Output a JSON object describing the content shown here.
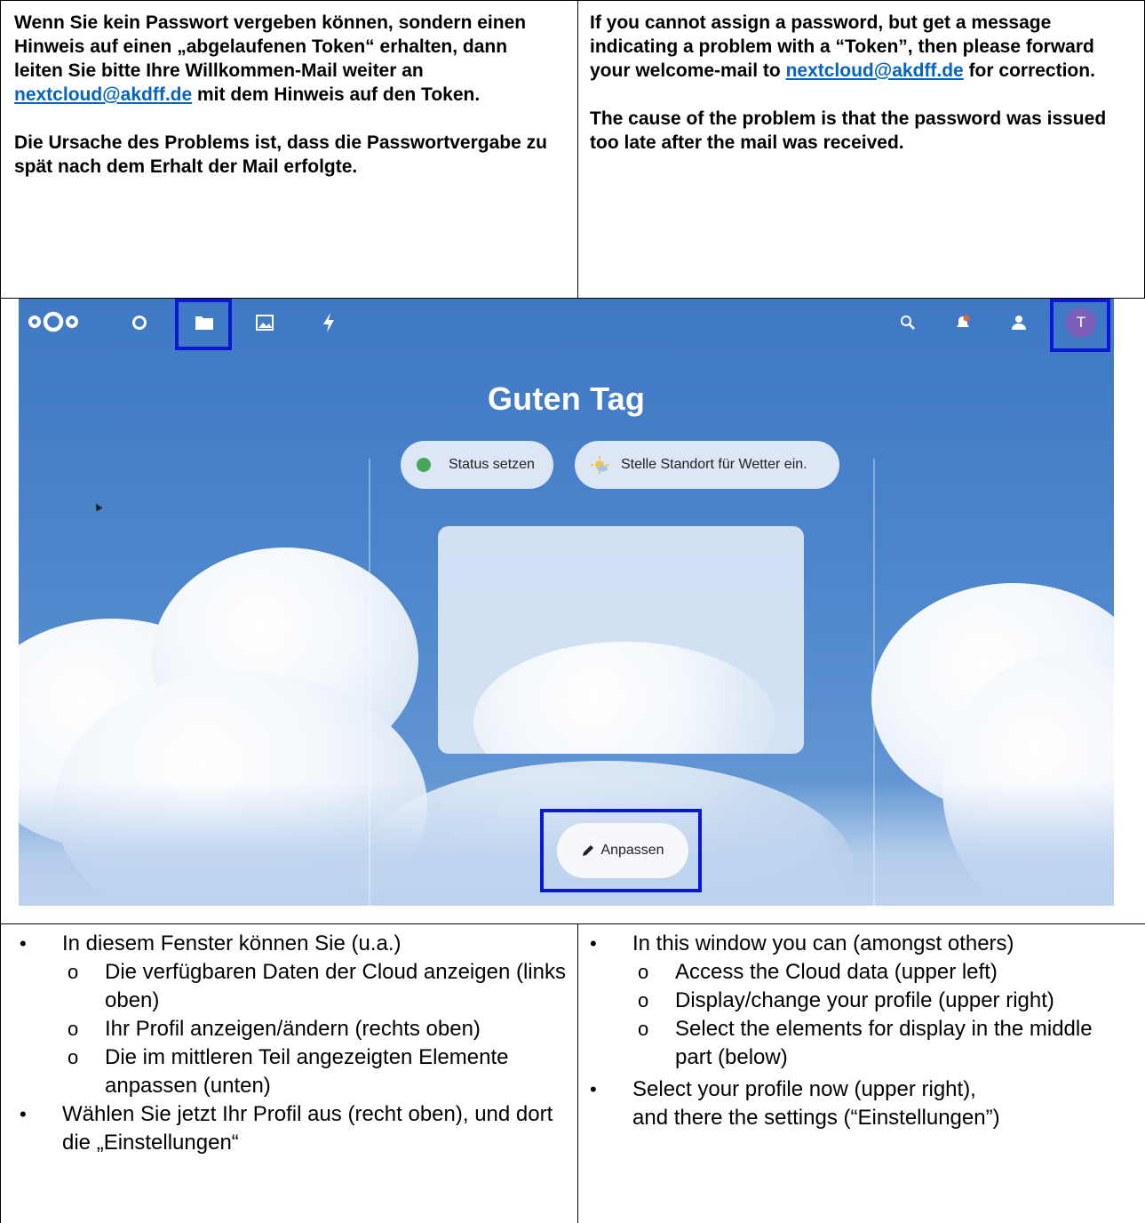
{
  "top_left": {
    "para1_before": "Wenn Sie kein Passwort vergeben können, sondern einen Hinweis auf einen „abgelaufenen Token“ erhalten, dann leiten Sie bitte Ihre Willkommen-Mail weiter an ",
    "para1_link": "nextcloud@akdff.de",
    "para1_after": " mit dem Hinweis auf den Token.",
    "para2": "Die Ursache des Problems ist, dass die Passwortvergabe zu spät nach dem Erhalt der Mail erfolgte."
  },
  "top_right": {
    "para1_before": "If you cannot assign a password, but get a message indicating a problem with a “Token”, then please forward your welcome-mail to ",
    "para1_link": "nextcloud@akdff.de",
    "para1_after": " for correction.",
    "para2": "The cause of the problem is that the password was issued too late after the mail was received."
  },
  "screenshot": {
    "greeting": "Guten Tag",
    "status_button": "Status setzen",
    "weather_button": "Stelle Standort für Wetter ein.",
    "customize_button": "Anpassen",
    "avatar_initial": "T",
    "nav_icons": [
      "dashboard-icon",
      "files-icon",
      "photos-icon",
      "activity-icon"
    ],
    "header_icons": [
      "search-icon",
      "notifications-icon",
      "contacts-icon",
      "avatar"
    ],
    "colors": {
      "highlight": "#0a18d6",
      "sky": "#4a80c7",
      "avatar": "#7b5fb8",
      "status_dot": "#46a65a"
    }
  },
  "bottom_left": {
    "intro": "In diesem Fenster können Sie (u.a.)",
    "sub": [
      "Die verfügbaren Daten der Cloud anzeigen (links oben)",
      "Ihr Profil anzeigen/ändern (rechts oben)",
      "Die im mittleren Teil angezeigten Elemente anpassen (unten)"
    ],
    "final": "Wählen Sie jetzt Ihr Profil aus (recht oben), und dort die „Einstellungen“"
  },
  "bottom_right": {
    "intro": "In this window you can (amongst others)",
    "sub": [
      "Access the Cloud data (upper left)",
      "Display/change your profile (upper right)",
      "Select the elements for display in the middle part (below)"
    ],
    "final_line1": "Select your profile now (upper right),",
    "final_line2": "and there the settings (“Einstellungen”)"
  }
}
